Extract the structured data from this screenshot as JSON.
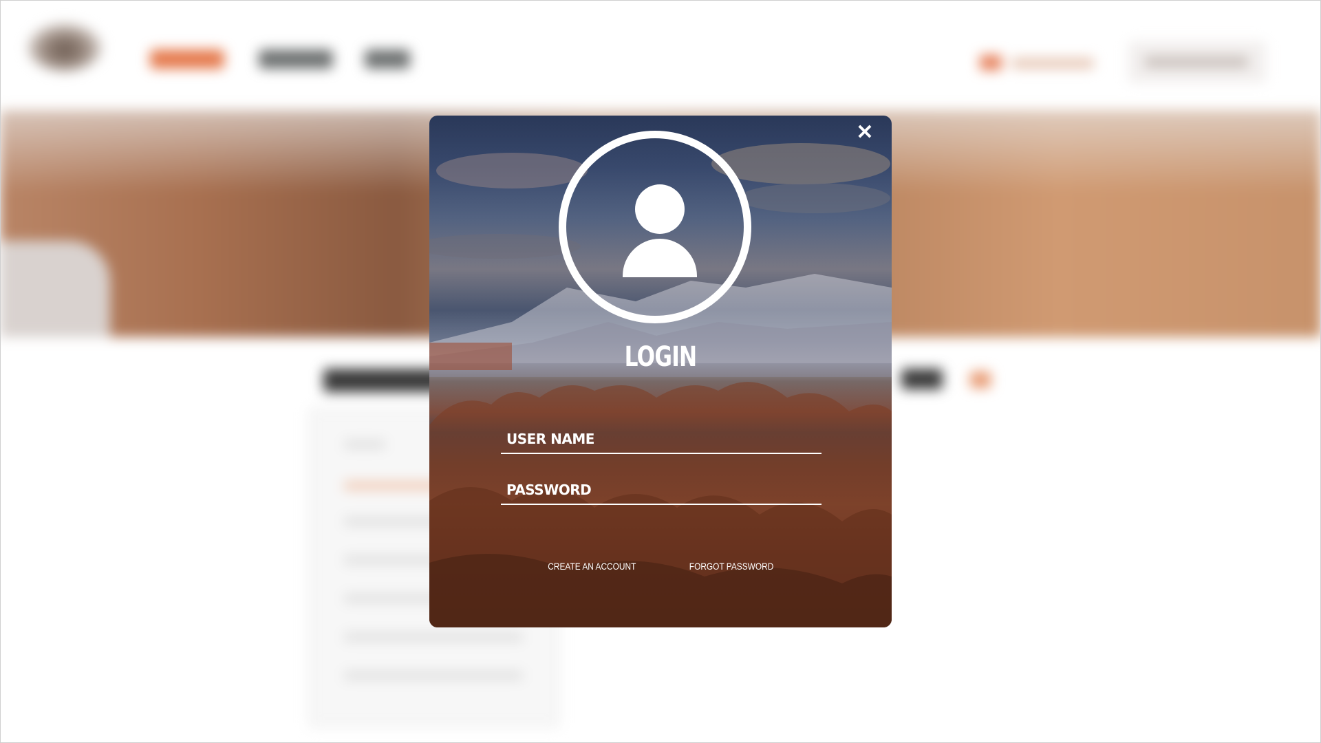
{
  "modal": {
    "close_symbol": "✕",
    "title": "LOGIN",
    "username_placeholder": "USER NAME",
    "password_placeholder": "PASSWORD",
    "create_account_label": "CREATE AN ACCOUNT",
    "forgot_password_label": "FORGOT PASSWORD"
  },
  "colors": {
    "accent": "#e57a4d",
    "modal_text": "#ffffff"
  },
  "icons": {
    "close": "close-icon",
    "avatar": "user-avatar-icon"
  }
}
